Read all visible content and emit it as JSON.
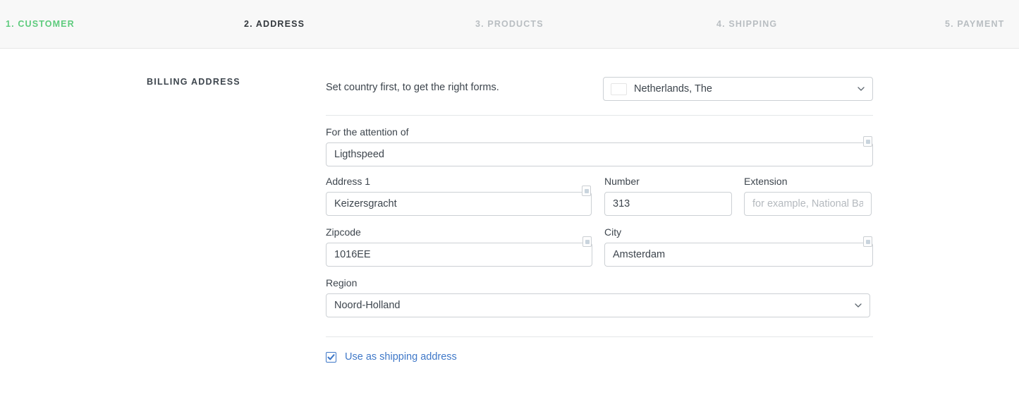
{
  "checkout_steps": [
    {
      "label": "1. CUSTOMER",
      "state": "completed"
    },
    {
      "label": "2. ADDRESS",
      "state": "active"
    },
    {
      "label": "3. PRODUCTS",
      "state": "upcoming"
    },
    {
      "label": "4. SHIPPING",
      "state": "upcoming"
    },
    {
      "label": "5. PAYMENT",
      "state": "upcoming"
    }
  ],
  "colors": {
    "step_completed": "#5ecb7d",
    "step_active": "#33383d",
    "step_upcoming": "#b9bec2",
    "link": "#3f78c8",
    "header_bg": "#f8f8f8",
    "input_border": "#ccd0d4",
    "divider": "#e4e6e8",
    "flag_red": "#ae1c28",
    "flag_white": "#ffffff",
    "flag_blue": "#21468b"
  },
  "section": {
    "title": "BILLING ADDRESS"
  },
  "country_row": {
    "hint": "Set country first, to get the right forms.",
    "select": {
      "value": "Netherlands, The",
      "flag": "netherlands-flag",
      "chevron": "chevron-down-icon"
    }
  },
  "fields": {
    "attention": {
      "label": "For the attention of",
      "value": "Ligthspeed",
      "placeholder": "",
      "required_marker": true
    },
    "address1": {
      "label": "Address 1",
      "value": "Keizersgracht",
      "placeholder": "",
      "required_marker": true
    },
    "number": {
      "label": "Number",
      "value": "313",
      "placeholder": "",
      "required_marker": false
    },
    "extension": {
      "label": "Extension",
      "value": "",
      "placeholder": "for example, National Bank",
      "required_marker": false
    },
    "zipcode": {
      "label": "Zipcode",
      "value": "1016EE",
      "placeholder": "",
      "required_marker": true
    },
    "city": {
      "label": "City",
      "value": "Amsterdam",
      "placeholder": "",
      "required_marker": true
    },
    "region": {
      "label": "Region",
      "value": "Noord-Holland",
      "chevron": "chevron-down-icon"
    }
  },
  "shipping_checkbox": {
    "label": "Use as shipping address",
    "checked": true,
    "icon": "checkmark-icon"
  }
}
